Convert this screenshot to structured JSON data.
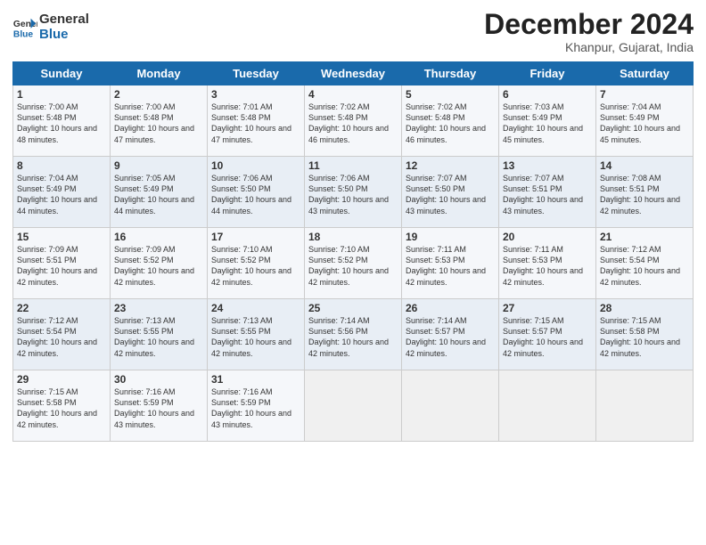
{
  "header": {
    "logo_general": "General",
    "logo_blue": "Blue",
    "month_title": "December 2024",
    "location": "Khanpur, Gujarat, India"
  },
  "weekdays": [
    "Sunday",
    "Monday",
    "Tuesday",
    "Wednesday",
    "Thursday",
    "Friday",
    "Saturday"
  ],
  "weeks": [
    [
      {
        "day": "1",
        "sunrise": "Sunrise: 7:00 AM",
        "sunset": "Sunset: 5:48 PM",
        "daylight": "Daylight: 10 hours and 48 minutes."
      },
      {
        "day": "2",
        "sunrise": "Sunrise: 7:00 AM",
        "sunset": "Sunset: 5:48 PM",
        "daylight": "Daylight: 10 hours and 47 minutes."
      },
      {
        "day": "3",
        "sunrise": "Sunrise: 7:01 AM",
        "sunset": "Sunset: 5:48 PM",
        "daylight": "Daylight: 10 hours and 47 minutes."
      },
      {
        "day": "4",
        "sunrise": "Sunrise: 7:02 AM",
        "sunset": "Sunset: 5:48 PM",
        "daylight": "Daylight: 10 hours and 46 minutes."
      },
      {
        "day": "5",
        "sunrise": "Sunrise: 7:02 AM",
        "sunset": "Sunset: 5:48 PM",
        "daylight": "Daylight: 10 hours and 46 minutes."
      },
      {
        "day": "6",
        "sunrise": "Sunrise: 7:03 AM",
        "sunset": "Sunset: 5:49 PM",
        "daylight": "Daylight: 10 hours and 45 minutes."
      },
      {
        "day": "7",
        "sunrise": "Sunrise: 7:04 AM",
        "sunset": "Sunset: 5:49 PM",
        "daylight": "Daylight: 10 hours and 45 minutes."
      }
    ],
    [
      {
        "day": "8",
        "sunrise": "Sunrise: 7:04 AM",
        "sunset": "Sunset: 5:49 PM",
        "daylight": "Daylight: 10 hours and 44 minutes."
      },
      {
        "day": "9",
        "sunrise": "Sunrise: 7:05 AM",
        "sunset": "Sunset: 5:49 PM",
        "daylight": "Daylight: 10 hours and 44 minutes."
      },
      {
        "day": "10",
        "sunrise": "Sunrise: 7:06 AM",
        "sunset": "Sunset: 5:50 PM",
        "daylight": "Daylight: 10 hours and 44 minutes."
      },
      {
        "day": "11",
        "sunrise": "Sunrise: 7:06 AM",
        "sunset": "Sunset: 5:50 PM",
        "daylight": "Daylight: 10 hours and 43 minutes."
      },
      {
        "day": "12",
        "sunrise": "Sunrise: 7:07 AM",
        "sunset": "Sunset: 5:50 PM",
        "daylight": "Daylight: 10 hours and 43 minutes."
      },
      {
        "day": "13",
        "sunrise": "Sunrise: 7:07 AM",
        "sunset": "Sunset: 5:51 PM",
        "daylight": "Daylight: 10 hours and 43 minutes."
      },
      {
        "day": "14",
        "sunrise": "Sunrise: 7:08 AM",
        "sunset": "Sunset: 5:51 PM",
        "daylight": "Daylight: 10 hours and 42 minutes."
      }
    ],
    [
      {
        "day": "15",
        "sunrise": "Sunrise: 7:09 AM",
        "sunset": "Sunset: 5:51 PM",
        "daylight": "Daylight: 10 hours and 42 minutes."
      },
      {
        "day": "16",
        "sunrise": "Sunrise: 7:09 AM",
        "sunset": "Sunset: 5:52 PM",
        "daylight": "Daylight: 10 hours and 42 minutes."
      },
      {
        "day": "17",
        "sunrise": "Sunrise: 7:10 AM",
        "sunset": "Sunset: 5:52 PM",
        "daylight": "Daylight: 10 hours and 42 minutes."
      },
      {
        "day": "18",
        "sunrise": "Sunrise: 7:10 AM",
        "sunset": "Sunset: 5:52 PM",
        "daylight": "Daylight: 10 hours and 42 minutes."
      },
      {
        "day": "19",
        "sunrise": "Sunrise: 7:11 AM",
        "sunset": "Sunset: 5:53 PM",
        "daylight": "Daylight: 10 hours and 42 minutes."
      },
      {
        "day": "20",
        "sunrise": "Sunrise: 7:11 AM",
        "sunset": "Sunset: 5:53 PM",
        "daylight": "Daylight: 10 hours and 42 minutes."
      },
      {
        "day": "21",
        "sunrise": "Sunrise: 7:12 AM",
        "sunset": "Sunset: 5:54 PM",
        "daylight": "Daylight: 10 hours and 42 minutes."
      }
    ],
    [
      {
        "day": "22",
        "sunrise": "Sunrise: 7:12 AM",
        "sunset": "Sunset: 5:54 PM",
        "daylight": "Daylight: 10 hours and 42 minutes."
      },
      {
        "day": "23",
        "sunrise": "Sunrise: 7:13 AM",
        "sunset": "Sunset: 5:55 PM",
        "daylight": "Daylight: 10 hours and 42 minutes."
      },
      {
        "day": "24",
        "sunrise": "Sunrise: 7:13 AM",
        "sunset": "Sunset: 5:55 PM",
        "daylight": "Daylight: 10 hours and 42 minutes."
      },
      {
        "day": "25",
        "sunrise": "Sunrise: 7:14 AM",
        "sunset": "Sunset: 5:56 PM",
        "daylight": "Daylight: 10 hours and 42 minutes."
      },
      {
        "day": "26",
        "sunrise": "Sunrise: 7:14 AM",
        "sunset": "Sunset: 5:57 PM",
        "daylight": "Daylight: 10 hours and 42 minutes."
      },
      {
        "day": "27",
        "sunrise": "Sunrise: 7:15 AM",
        "sunset": "Sunset: 5:57 PM",
        "daylight": "Daylight: 10 hours and 42 minutes."
      },
      {
        "day": "28",
        "sunrise": "Sunrise: 7:15 AM",
        "sunset": "Sunset: 5:58 PM",
        "daylight": "Daylight: 10 hours and 42 minutes."
      }
    ],
    [
      {
        "day": "29",
        "sunrise": "Sunrise: 7:15 AM",
        "sunset": "Sunset: 5:58 PM",
        "daylight": "Daylight: 10 hours and 42 minutes."
      },
      {
        "day": "30",
        "sunrise": "Sunrise: 7:16 AM",
        "sunset": "Sunset: 5:59 PM",
        "daylight": "Daylight: 10 hours and 43 minutes."
      },
      {
        "day": "31",
        "sunrise": "Sunrise: 7:16 AM",
        "sunset": "Sunset: 5:59 PM",
        "daylight": "Daylight: 10 hours and 43 minutes."
      },
      null,
      null,
      null,
      null
    ]
  ]
}
